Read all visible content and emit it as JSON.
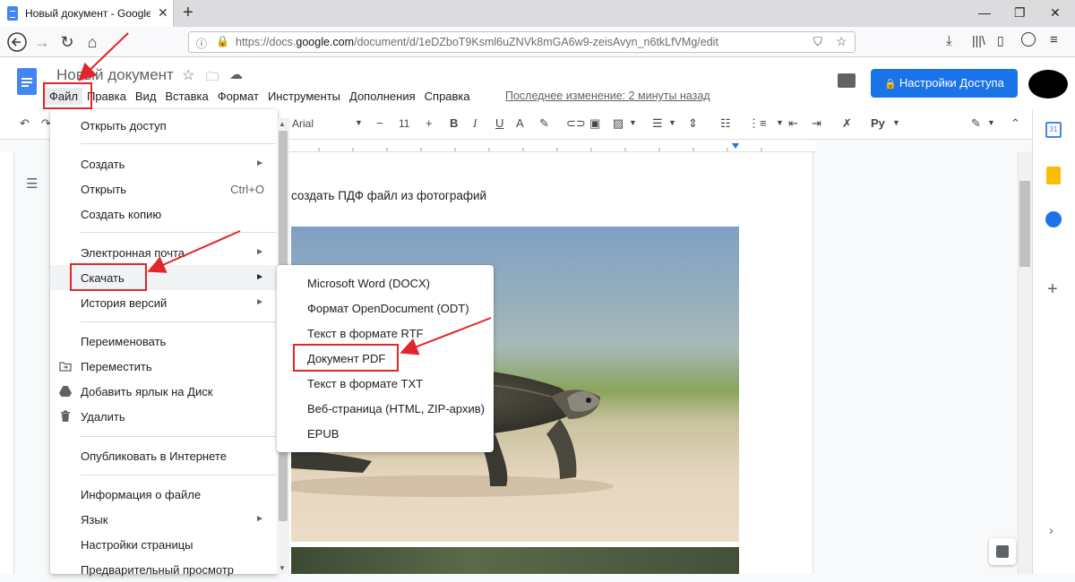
{
  "browser": {
    "tab_title": "Новый документ - Google Доки",
    "url_prefix": "https://docs.",
    "url_host": "google.com",
    "url_path": "/document/d/1eDZboT9Ksml6uZNVk8mGA6w9-zeisAvyn_n6tkLfVMg/edit"
  },
  "docs": {
    "title": "Новый документ",
    "menu": [
      "Файл",
      "Правка",
      "Вид",
      "Вставка",
      "Формат",
      "Инструменты",
      "Дополнения",
      "Справка"
    ],
    "last_edit": "Последнее изменение: 2 минуты назад",
    "share_label": "Настройки Доступа"
  },
  "toolbar": {
    "font": "Arial",
    "font_size": "11",
    "minus": "−",
    "plus": "+",
    "bold": "B",
    "italic": "I",
    "underline": "U",
    "text_color": "A"
  },
  "document": {
    "text": "создать ПДФ файл из фотографий"
  },
  "file_menu": {
    "items": [
      {
        "label": "Открыть доступ"
      },
      {
        "label": "Создать",
        "submenu": true
      },
      {
        "label": "Открыть",
        "shortcut": "Ctrl+O"
      },
      {
        "label": "Создать копию"
      },
      {
        "label": "Электронная почта",
        "submenu": true
      },
      {
        "label": "Скачать",
        "submenu": true,
        "highlighted": true
      },
      {
        "label": "История версий",
        "submenu": true
      },
      {
        "label": "Переименовать"
      },
      {
        "label": "Переместить",
        "icon": "folder-move-icon"
      },
      {
        "label": "Добавить ярлык на Диск",
        "icon": "drive-shortcut-icon"
      },
      {
        "label": "Удалить",
        "icon": "trash-icon"
      },
      {
        "label": "Опубликовать в Интернете"
      },
      {
        "label": "Информация о файле"
      },
      {
        "label": "Язык",
        "submenu": true
      },
      {
        "label": "Настройки страницы"
      },
      {
        "label": "Предварительный просмотр"
      }
    ]
  },
  "download_menu": {
    "items": [
      {
        "label": "Microsoft Word (DOCX)"
      },
      {
        "label": "Формат OpenDocument (ODT)"
      },
      {
        "label": "Текст в формате RTF"
      },
      {
        "label": "Документ PDF",
        "highlighted": true
      },
      {
        "label": "Текст в формате TXT"
      },
      {
        "label": "Веб-страница (HTML, ZIP-архив)"
      },
      {
        "label": "EPUB"
      }
    ]
  },
  "colors": {
    "accent": "#1a73e8",
    "annotation": "#e0262b"
  }
}
